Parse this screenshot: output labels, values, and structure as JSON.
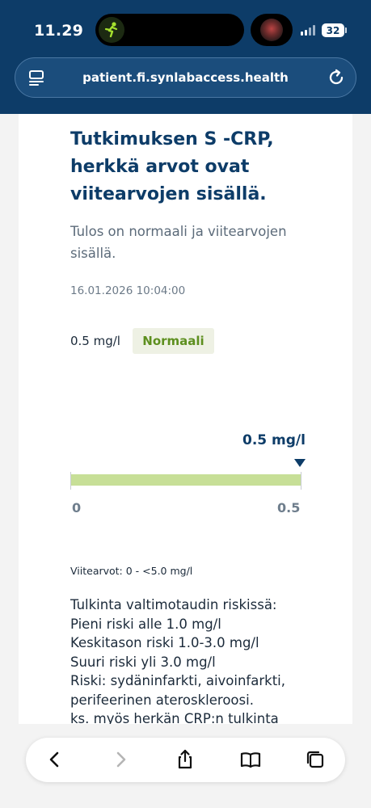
{
  "status_bar": {
    "time": "11.29",
    "battery": "32"
  },
  "browser": {
    "url": "patient.fi.synlabaccess.health",
    "icons": {
      "left": "reader-icon",
      "right": "reload-icon"
    }
  },
  "result": {
    "title_lines": [
      "Tutkimuksen S -CRP,",
      "herkkä arvot ovat",
      "viitearvojen sisällä."
    ],
    "description_lines": [
      "Tulos on normaali ja viitearvojen",
      "sisällä."
    ],
    "datetime": "16.01.2026 10:04:00",
    "value": "0.5 mg/l",
    "status_badge": "Normaali",
    "status_color": "#5d8f1f",
    "badge_bg": "#eef1e4"
  },
  "range_bar": {
    "marker_label": "0.5 mg/l",
    "min_label": "0",
    "max_label": "0.5",
    "marker_fraction": 1.0,
    "fill_color": "#c7df97"
  },
  "reference": "Viitearvot: 0 - <5.0 mg/l",
  "interpretation_lines": [
    "Tulkinta valtimotaudin riskissä:",
    "Pieni riski alle 1.0 mg/l",
    "Keskitason riski 1.0-3.0 mg/l",
    "Suuri riski yli 3.0 mg/l",
    "Riski: sydäninfarkti, aivoinfarkti,",
    "perifeerinen ateroskleroosi.",
    "ks. myös herkän CRP:n tulkinta"
  ],
  "toolbar": {
    "icons": [
      "back-icon",
      "forward-icon",
      "share-icon",
      "bookmarks-icon",
      "tabs-icon"
    ]
  },
  "colors": {
    "header_bg": "#0d3c68",
    "accent": "#0d3c68"
  }
}
